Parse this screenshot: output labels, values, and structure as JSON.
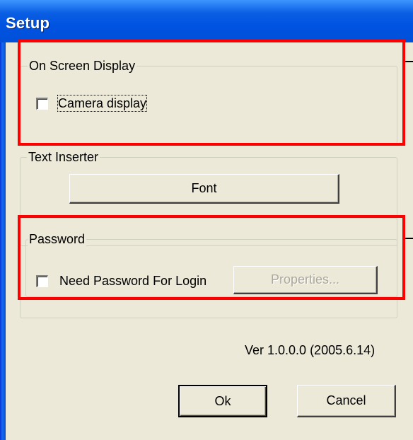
{
  "window": {
    "title": "Setup"
  },
  "osd_group": {
    "label": "On Screen Display",
    "camera_display": {
      "label": "Camera display",
      "checked": false
    }
  },
  "text_inserter_group": {
    "label": "Text Inserter",
    "font_button": "Font"
  },
  "password_group": {
    "label": "Password",
    "need_password": {
      "label": "Need Password For Login",
      "checked": false
    },
    "properties_button": "Properties..."
  },
  "footer": {
    "version": "Ver 1.0.0.0 (2005.6.14)",
    "ok_button": "Ok",
    "cancel_button": "Cancel"
  },
  "colors": {
    "titlebar": "#0053e1",
    "dialog_bg": "#ece9d8",
    "annotation": "#ff0000"
  }
}
